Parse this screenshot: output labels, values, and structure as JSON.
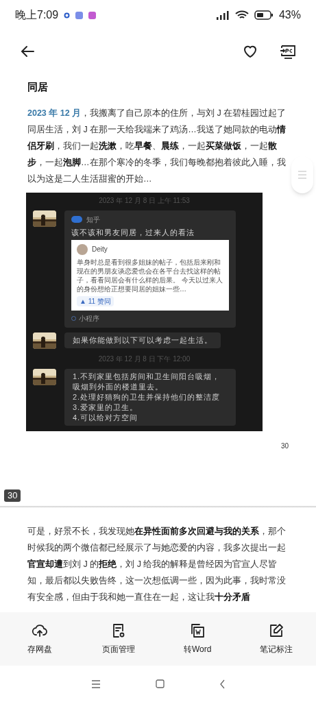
{
  "status_bar": {
    "time": "晚上7:09",
    "battery": "43%"
  },
  "article": {
    "title": "同居",
    "paragraph_1": [
      {
        "kind": "date",
        "text": "2023 年 12 月"
      },
      {
        "kind": "plain",
        "text": "，我搬离了自己原本的住所，与刘 J 在碧桂园过起了同居生活，刘 J 在那一天给我端来了鸡汤…我送了她同款的电动"
      },
      {
        "kind": "bold",
        "text": "情侣牙刷"
      },
      {
        "kind": "plain",
        "text": "，我们一起"
      },
      {
        "kind": "bold",
        "text": "洗漱"
      },
      {
        "kind": "plain",
        "text": "，吃"
      },
      {
        "kind": "bold",
        "text": "早餐"
      },
      {
        "kind": "plain",
        "text": "、"
      },
      {
        "kind": "bold",
        "text": "晨练"
      },
      {
        "kind": "plain",
        "text": "，一起"
      },
      {
        "kind": "bold",
        "text": "买菜做饭"
      },
      {
        "kind": "plain",
        "text": "，一起"
      },
      {
        "kind": "bold",
        "text": "散步"
      },
      {
        "kind": "plain",
        "text": "，一起"
      },
      {
        "kind": "bold",
        "text": "泡脚"
      },
      {
        "kind": "plain",
        "text": "…在那个寒冷的冬季，我们每晚都抱着彼此入睡，我以为这是二人生活甜蜜的开始…"
      }
    ],
    "chat_screenshot": [
      {
        "kind": "timestamp",
        "text": "2023 年 12 月 8 日 上午 11:53"
      },
      {
        "kind": "link_card",
        "source": "知乎",
        "title": "该不该和男友同居，过来人的看法",
        "author": "Deity",
        "excerpt": "单身时总是看到很多姐妹的帖子，包括后来刚和现在的男朋友谈恋爱也会在各平台去找这样的帖子，看看同居会有什么样的后果。 今天以过来人的身份想给正想要同居的姐妹一些…",
        "votes": "▲ 11 赞同",
        "footer": "小程序"
      },
      {
        "kind": "message",
        "text": "如果你能做到以下可以考虑一起生活。"
      },
      {
        "kind": "timestamp",
        "text": "2023 年 12 月 8 日 下午 12:00"
      },
      {
        "kind": "message",
        "text": "1.不到家里包括房间和卫生间阳台吸烟，吸烟到外面的楼道里去。\n2.处理好猫狗的卫生并保持他们的整洁度\n3.爱家里的卫生。\n4.可以给对方空间"
      }
    ],
    "page_number": "30",
    "page_badge": "30",
    "paragraph_2": [
      {
        "kind": "plain",
        "text": "可是，好景不长，我发现她"
      },
      {
        "kind": "bold",
        "text": "在异性面前多次回避与我的关系"
      },
      {
        "kind": "plain",
        "text": "，那个时候我的两个微信都已经展示了与她恋爱的内容，我多次提出一起"
      },
      {
        "kind": "bold",
        "text": "官宣却遭"
      },
      {
        "kind": "plain",
        "text": "到刘 J 的"
      },
      {
        "kind": "bold",
        "text": "拒绝"
      },
      {
        "kind": "plain",
        "text": "，刘 J 给我的解释是曾经因为官宣人尽皆知，最后都以失败告终，这一次想低调一些，因为此事，我时常没有安全感，但由于我和她一直住在一起，这让我"
      },
      {
        "kind": "bold",
        "text": "十分矛盾"
      }
    ]
  },
  "toolbar": [
    {
      "label": "存网盘"
    },
    {
      "label": "页面管理"
    },
    {
      "label": "转Word"
    },
    {
      "label": "笔记标注"
    }
  ]
}
